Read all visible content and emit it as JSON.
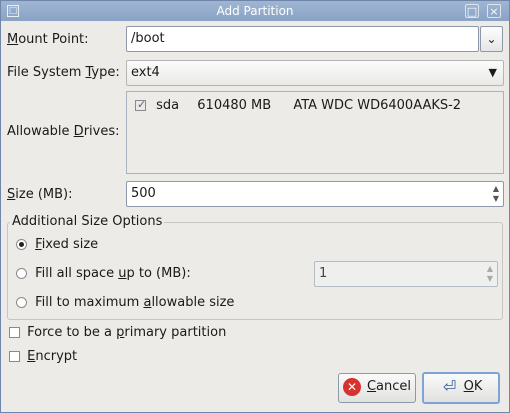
{
  "window": {
    "title": "Add Partition"
  },
  "mount_point": {
    "label": "Mount Point:",
    "value": "/boot"
  },
  "fs_type": {
    "label": "File System Type:",
    "value": "ext4"
  },
  "drives": {
    "label": "Allowable Drives:",
    "items": [
      {
        "name": "sda",
        "size": "610480 MB",
        "model": "ATA WDC WD6400AAKS-2",
        "checked": true
      }
    ]
  },
  "size": {
    "label": "Size (MB):",
    "value": "500"
  },
  "size_options": {
    "title": "Additional Size Options",
    "fixed": "Fixed size",
    "fill_up_to": "Fill all space up to (MB):",
    "fill_up_to_value": "1",
    "fill_max": "Fill to maximum allowable size",
    "selected": "fixed"
  },
  "primary": {
    "label": "Force to be a primary partition",
    "checked": false
  },
  "encrypt": {
    "label": "Encrypt",
    "checked": false
  },
  "buttons": {
    "cancel": "Cancel",
    "ok": "OK"
  }
}
